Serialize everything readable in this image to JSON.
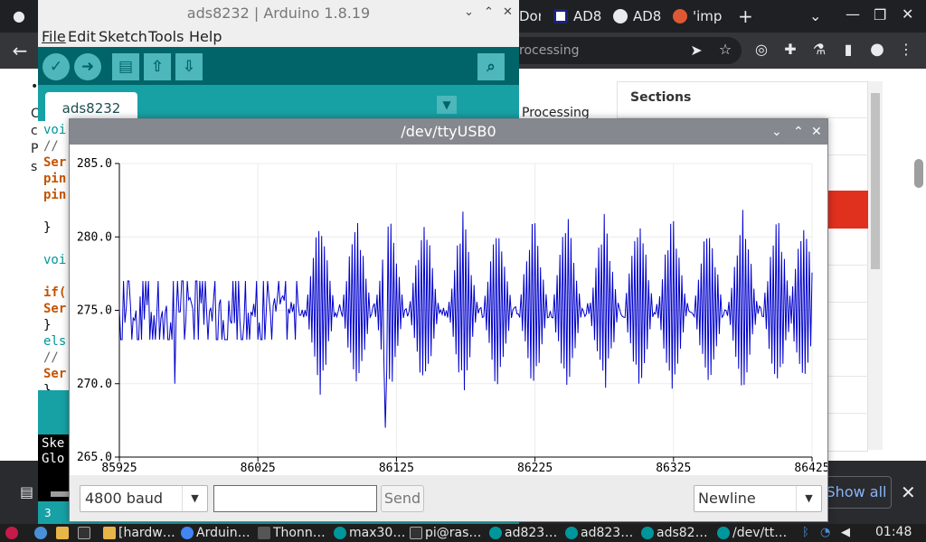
{
  "browser": {
    "tabs": [
      "Dor",
      "AD8",
      "AD8",
      "'imp"
    ],
    "omnibox_text": "rocessing",
    "page": {
      "sections_title": "Sections",
      "processing_text": "Processing",
      "left_fragments": [
        "•",
        "C",
        "c",
        "P",
        "s"
      ]
    },
    "downloads_bar": {
      "show_all_label": "Show all"
    }
  },
  "arduino": {
    "title": "ads8232 | Arduino 1.8.19",
    "menu": [
      "File",
      "Edit",
      "Sketch",
      "Tools",
      "Help"
    ],
    "tab_name": "ads8232",
    "code": [
      {
        "t": "voi",
        "c": "kw-blue"
      },
      {
        "t": "//",
        "c": "cmt"
      },
      {
        "t": "Ser",
        "c": "kw-orange"
      },
      {
        "t": "pin",
        "c": "kw-orange"
      },
      {
        "t": "pin",
        "c": "kw-orange"
      },
      {
        "t": "",
        "c": ""
      },
      {
        "t": "}",
        "c": ""
      },
      {
        "t": "",
        "c": ""
      },
      {
        "t": "voi",
        "c": "kw-blue"
      },
      {
        "t": "",
        "c": ""
      },
      {
        "t": "if(",
        "c": "kw-orange"
      },
      {
        "t": "Ser",
        "c": "kw-orange"
      },
      {
        "t": "}",
        "c": ""
      },
      {
        "t": "els",
        "c": "kw-blue"
      },
      {
        "t": "//",
        "c": "cmt"
      },
      {
        "t": "Ser",
        "c": "kw-orange"
      },
      {
        "t": "}",
        "c": ""
      }
    ],
    "console": [
      "Ske",
      "Glo"
    ],
    "line_number": "3"
  },
  "plotter": {
    "title": "/dev/ttyUSB0",
    "baud": "4800 baud",
    "send_label": "Send",
    "send_value": "",
    "line_ending": "Newline"
  },
  "taskbar": {
    "items": [
      "[hardw…",
      "Arduin…",
      "Thonn…",
      "max30…",
      "pi@ras…",
      "ad823…",
      "ad823…",
      "ads82…",
      "/dev/tt…"
    ],
    "clock": "01:48"
  },
  "chart_data": {
    "type": "line",
    "title": "",
    "xlabel": "",
    "ylabel": "",
    "xlim": [
      85925,
      86425
    ],
    "ylim": [
      265.0,
      285.0
    ],
    "x_ticks": [
      "85925",
      "86025",
      "86125",
      "86225",
      "86325",
      "86425"
    ],
    "y_ticks": [
      "285.0",
      "280.0",
      "275.0",
      "270.0",
      "265.0"
    ],
    "grid": true,
    "series": [
      {
        "color": "#0000cc",
        "segments": [
          {
            "x_start": 85925,
            "x_end": 86054,
            "min": 273.0,
            "max": 277.0,
            "outliers": [
              [
                85965,
                270.0
              ]
            ],
            "pattern": "noise"
          },
          {
            "x_start": 86054,
            "x_end": 86425,
            "min": 269.0,
            "max": 282.0,
            "bursts": [
              86070,
              86096,
              86120,
              86145,
              86173,
              86198,
              86224,
              86248,
              86275,
              86300,
              86324,
              86350,
              86375,
              86400,
              86419
            ],
            "deep_low": [
              [
                86117,
                267.0
              ]
            ],
            "pattern": "oscillation"
          }
        ]
      }
    ]
  }
}
